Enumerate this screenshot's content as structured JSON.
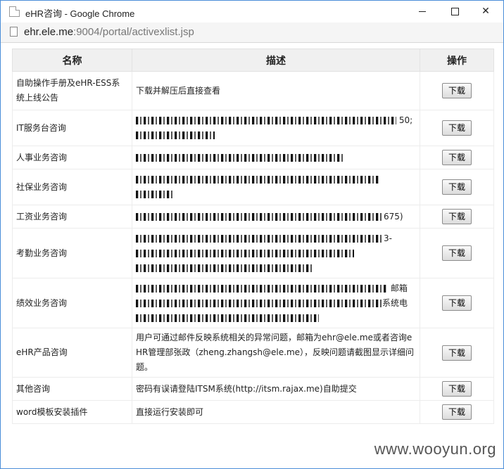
{
  "window": {
    "title": "eHR咨询 - Google Chrome",
    "url_host": "ehr.ele.me",
    "url_rest": ":9004/portal/activexlist.jsp"
  },
  "table": {
    "headers": {
      "name": "名称",
      "desc": "描述",
      "op": "操作"
    },
    "button_label": "下载",
    "rows": [
      {
        "name": "自助操作手册及eHR-ESS系统上线公告",
        "desc": "下载并解压后直接查看"
      },
      {
        "name": "IT服务台咨询",
        "tail": "50;"
      },
      {
        "name": "人事业务咨询"
      },
      {
        "name": "社保业务咨询"
      },
      {
        "name": "工资业务咨询",
        "tail": "675)"
      },
      {
        "name": "考勤业务咨询",
        "tail": "3-"
      },
      {
        "name": "绩效业务咨询",
        "tail": "邮箱",
        "tail2": "系统电"
      },
      {
        "name": "eHR产品咨询",
        "desc": "用户可通过邮件反映系统相关的异常问题，邮箱为ehr@ele.me或者咨询eHR管理部张政（zheng.zhangsh@ele.me），反映问题请截图显示详细问题。"
      },
      {
        "name": "其他咨询",
        "desc": "密码有误请登陆ITSM系统(http://itsm.rajax.me)自助提交"
      },
      {
        "name": "word模板安装插件",
        "desc": "直接运行安装即可"
      }
    ]
  },
  "watermark": "www.wooyun.org"
}
